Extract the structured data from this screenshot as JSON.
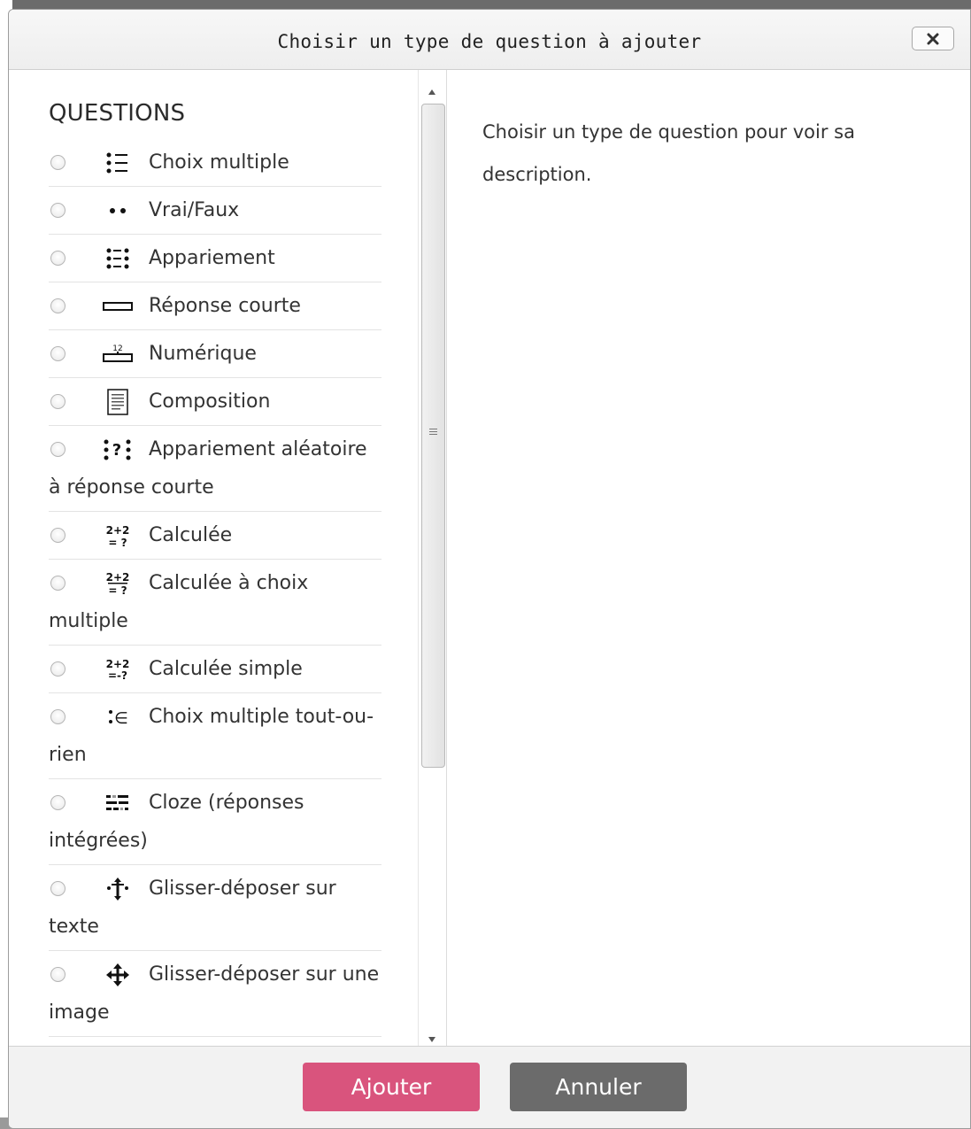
{
  "dialog": {
    "title": "Choisir un type de question à ajouter",
    "close_icon": "close-x-icon"
  },
  "options": {
    "section_label": "QUESTIONS",
    "items": [
      {
        "label": "Choix multiple",
        "icon": "multichoice-icon",
        "wrap": ""
      },
      {
        "label": "Vrai/Faux",
        "icon": "truefalse-icon",
        "wrap": ""
      },
      {
        "label": "Appariement",
        "icon": "match-icon",
        "wrap": ""
      },
      {
        "label": "Réponse courte",
        "icon": "shortanswer-icon",
        "wrap": ""
      },
      {
        "label": "Numérique",
        "icon": "numerical-icon",
        "icon_text": "12",
        "wrap": ""
      },
      {
        "label": "Composition",
        "icon": "essay-icon",
        "wrap": ""
      },
      {
        "label": "Appariement aléatoire",
        "icon": "randomsamatch-icon",
        "wrap": "à réponse courte"
      },
      {
        "label": "Calculée",
        "icon": "calculated-icon",
        "icon_text": "2+2 = ?",
        "wrap": ""
      },
      {
        "label": "Calculée à choix",
        "icon": "calculatedmulti-icon",
        "icon_text": "2+2 = ?",
        "wrap": "multiple"
      },
      {
        "label": "Calculée simple",
        "icon": "calculatedsimple-icon",
        "icon_text": "2+2 =?",
        "wrap": ""
      },
      {
        "label": "Choix multiple tout-ou-",
        "icon": "multichoiceset-icon",
        "wrap": "rien"
      },
      {
        "label": "Cloze (réponses",
        "icon": "multianswer-icon",
        "wrap": "intégrées)"
      },
      {
        "label": "Glisser-déposer sur",
        "icon": "ddwtos-icon",
        "wrap": "texte"
      },
      {
        "label": "Glisser-déposer sur une",
        "icon": "ddimageortext-icon",
        "wrap": "image"
      }
    ]
  },
  "description": {
    "text": "Choisir un type de question pour voir sa description."
  },
  "footer": {
    "add_label": "Ajouter",
    "cancel_label": "Annuler"
  },
  "colors": {
    "primary": "#d9547d",
    "secondary": "#6b6b6b",
    "backdrop": "#6b6b6b"
  }
}
